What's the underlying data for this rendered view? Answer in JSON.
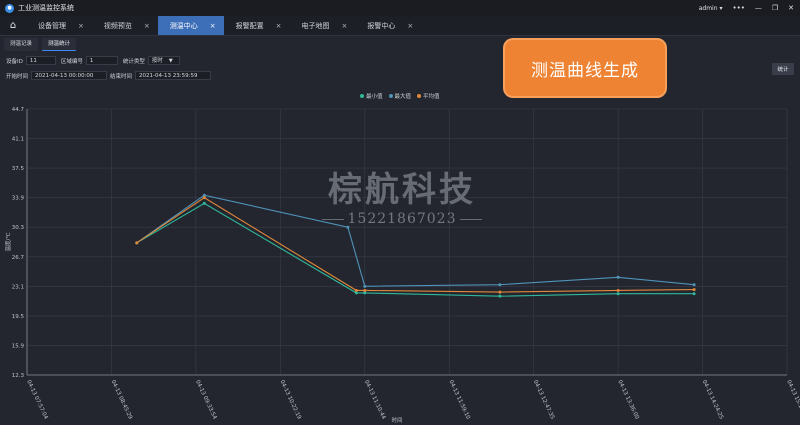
{
  "app": {
    "title": "工业测温监控系统",
    "user": "admin"
  },
  "tabs": [
    {
      "label": "设备管理"
    },
    {
      "label": "视频预览"
    },
    {
      "label": "测温中心"
    },
    {
      "label": "报警配置"
    },
    {
      "label": "电子地图"
    },
    {
      "label": "报警中心"
    }
  ],
  "subtabs": [
    {
      "label": "测温记录"
    },
    {
      "label": "测温统计"
    }
  ],
  "form": {
    "device_id_label": "设备ID",
    "device_id_value": "11",
    "region_label": "区域编号",
    "region_value": "1",
    "stat_type_label": "统计类型",
    "stat_type_value": "按时",
    "start_label": "开始时间",
    "start_value": "2021-04-13 00:00:00",
    "end_label": "结束时间",
    "end_value": "2021-04-13 23:59:59",
    "stat_button": "统计"
  },
  "callout": {
    "text": "测温曲线生成"
  },
  "watermark": {
    "company": "棕航科技",
    "phone": "15221867023"
  },
  "colors": {
    "min": "#2fb89a",
    "max": "#4f93b8",
    "avg": "#e2883a",
    "accent": "#3d6fb8",
    "callout": "#ee8433"
  },
  "chart_data": {
    "type": "line",
    "xlabel": "时间",
    "ylabel": "温度/℃",
    "ylim": [
      12.3,
      44.7
    ],
    "yticks": [
      "12.3",
      "15.9",
      "19.5",
      "23.1",
      "26.7",
      "30.3",
      "33.9",
      "37.5",
      "41.1",
      "44.7"
    ],
    "xticks": [
      "04-13 07:57:04",
      "04-13 08:45:29",
      "04-13 09:33:54",
      "04-13 10:22:19",
      "04-13 11:10:44",
      "04-13 11:59:10",
      "04-13 12:47:35",
      "04-13 13:36:00",
      "04-13 14:24:25",
      "04-13 15:12:51"
    ],
    "grid": true,
    "legend": "top-center",
    "series": [
      {
        "name": "最小值",
        "color": "#2fb89a",
        "points": [
          {
            "x": 1.3,
            "y": 28.4
          },
          {
            "x": 2.1,
            "y": 33.2
          },
          {
            "x": 3.9,
            "y": 22.3
          },
          {
            "x": 4.0,
            "y": 22.3
          },
          {
            "x": 5.6,
            "y": 21.9
          },
          {
            "x": 7.0,
            "y": 22.2
          },
          {
            "x": 7.9,
            "y": 22.2
          }
        ]
      },
      {
        "name": "最大值",
        "color": "#4f93b8",
        "points": [
          {
            "x": 1.3,
            "y": 28.4
          },
          {
            "x": 2.1,
            "y": 34.2
          },
          {
            "x": 3.8,
            "y": 30.3
          },
          {
            "x": 4.0,
            "y": 23.1
          },
          {
            "x": 5.6,
            "y": 23.3
          },
          {
            "x": 7.0,
            "y": 24.2
          },
          {
            "x": 7.9,
            "y": 23.3
          }
        ]
      },
      {
        "name": "平均值",
        "color": "#e2883a",
        "points": [
          {
            "x": 1.3,
            "y": 28.4
          },
          {
            "x": 2.1,
            "y": 33.9
          },
          {
            "x": 3.9,
            "y": 22.6
          },
          {
            "x": 4.0,
            "y": 22.6
          },
          {
            "x": 5.6,
            "y": 22.4
          },
          {
            "x": 7.0,
            "y": 22.6
          },
          {
            "x": 7.9,
            "y": 22.7
          }
        ]
      }
    ]
  }
}
